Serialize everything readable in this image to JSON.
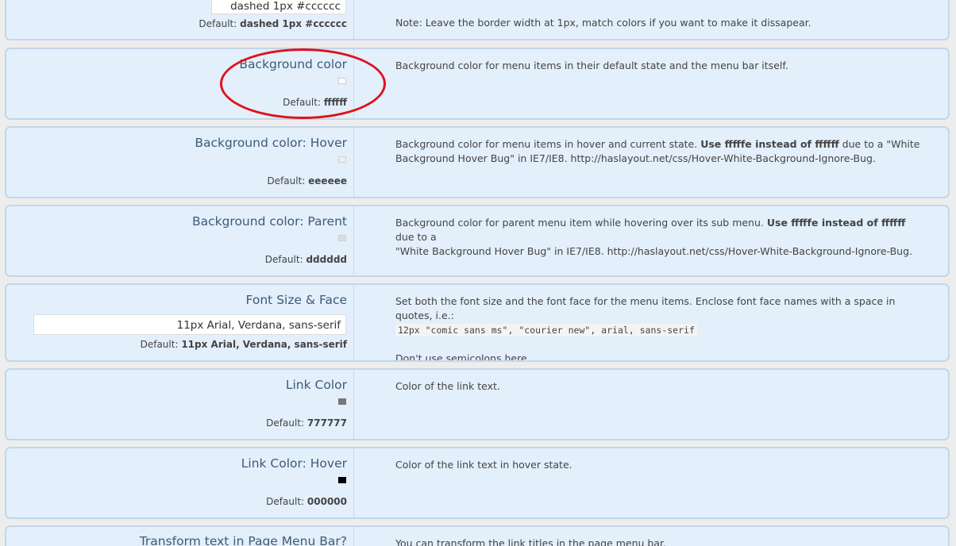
{
  "rows": {
    "border": {
      "input_value": "dashed 1px #cccccc",
      "default_label": "Default:",
      "default_value": "dashed 1px #cccccc",
      "description": "Note: Leave the border width at 1px, match colors if you want to make it dissapear."
    },
    "bg_color": {
      "label": "Background color",
      "swatch_color": "#ffffff",
      "default_label": "Default:",
      "default_value": "ffffff",
      "description": "Background color for menu items in their default state and the menu bar itself."
    },
    "bg_hover": {
      "label": "Background color: Hover",
      "swatch_color": "#eeeeee",
      "default_label": "Default:",
      "default_value": "eeeeee",
      "description_pre": "Background color for menu items in hover and current state. ",
      "description_bold": "Use fffffe instead of ffffff",
      "description_post": " due to a \"White",
      "description_line2": "Background Hover Bug\" in IE7/IE8. http://haslayout.net/css/Hover-White-Background-Ignore-Bug."
    },
    "bg_parent": {
      "label": "Background color: Parent",
      "swatch_color": "#dddddd",
      "default_label": "Default:",
      "default_value": "dddddd",
      "description_pre": "Background color for parent menu item while hovering over its sub menu. ",
      "description_bold": "Use fffffe instead of ffffff",
      "description_post": " due to a",
      "description_line2": "\"White Background Hover Bug\" in IE7/IE8. http://haslayout.net/css/Hover-White-Background-Ignore-Bug."
    },
    "font": {
      "label": "Font Size & Face",
      "input_value": "11px Arial, Verdana, sans-serif",
      "default_label": "Default:",
      "default_value": "11px Arial, Verdana, sans-serif",
      "description": "Set both the font size and the font face for the menu items. Enclose font face names with a space in quotes, i.e.:",
      "code": "12px \"comic sans ms\", \"courier new\", arial, sans-serif",
      "note": "Don't use semicolons here."
    },
    "link_color": {
      "label": "Link Color",
      "swatch_color": "#777777",
      "default_label": "Default:",
      "default_value": "777777",
      "description": "Color of the link text."
    },
    "link_hover": {
      "label": "Link Color: Hover",
      "swatch_color": "#000000",
      "default_label": "Default:",
      "default_value": "000000",
      "description": "Color of the link text in hover state."
    },
    "transform": {
      "label": "Transform text in Page Menu Bar?",
      "description": "You can transform the link titles in the page menu bar."
    }
  },
  "annotation_color": "#e0121b"
}
